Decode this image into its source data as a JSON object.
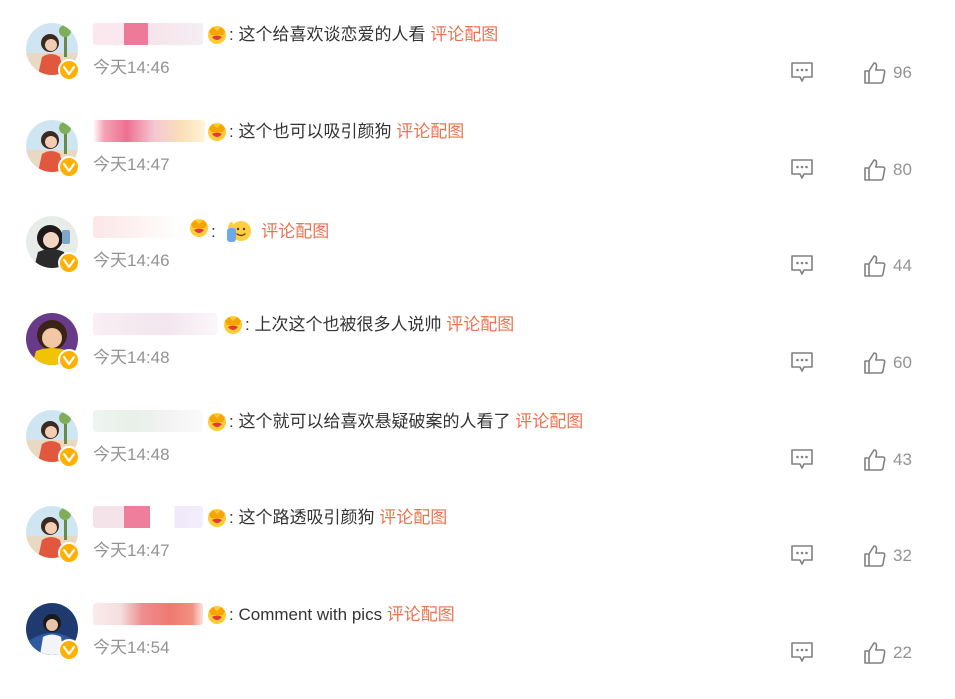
{
  "colors": {
    "link": "#eb7350",
    "muted": "#939393",
    "text": "#333333",
    "verified": "#ffb000"
  },
  "comments": [
    {
      "colon": ":",
      "text": "这个给喜欢谈恋爱的人看",
      "pic_link": "评论配图",
      "time": "今天14:46",
      "likes": "96",
      "avatar": "woman-beach-avatar",
      "icons": [
        "crown-badge-icon",
        "verified-icon",
        "comment-icon",
        "thumbs-up-icon"
      ]
    },
    {
      "colon": ":",
      "text": "这个也可以吸引颜狗",
      "pic_link": "评论配图",
      "time": "今天14:47",
      "likes": "80",
      "avatar": "woman-beach-avatar"
    },
    {
      "colon": ":",
      "text": "",
      "emoji": "wave-emoji",
      "pic_link": "评论配图",
      "time": "今天14:46",
      "likes": "44",
      "avatar": "woman-portrait-avatar"
    },
    {
      "colon": ":",
      "text": "上次这个也被很多人说帅",
      "pic_link": "评论配图",
      "time": "今天14:48",
      "likes": "60",
      "avatar": "woman-yellow-avatar"
    },
    {
      "colon": ":",
      "text": "这个就可以给喜欢悬疑破案的人看了",
      "pic_link": "评论配图",
      "time": "今天14:48",
      "likes": "43",
      "avatar": "woman-beach-avatar"
    },
    {
      "colon": ":",
      "text": "这个路透吸引颜狗",
      "pic_link": "评论配图",
      "time": "今天14:47",
      "likes": "32",
      "avatar": "woman-beach-avatar"
    },
    {
      "colon": ":",
      "text": "Comment with pics",
      "pic_link": "评论配图",
      "time": "今天14:54",
      "likes": "22",
      "avatar": "man-blue-avatar"
    }
  ]
}
